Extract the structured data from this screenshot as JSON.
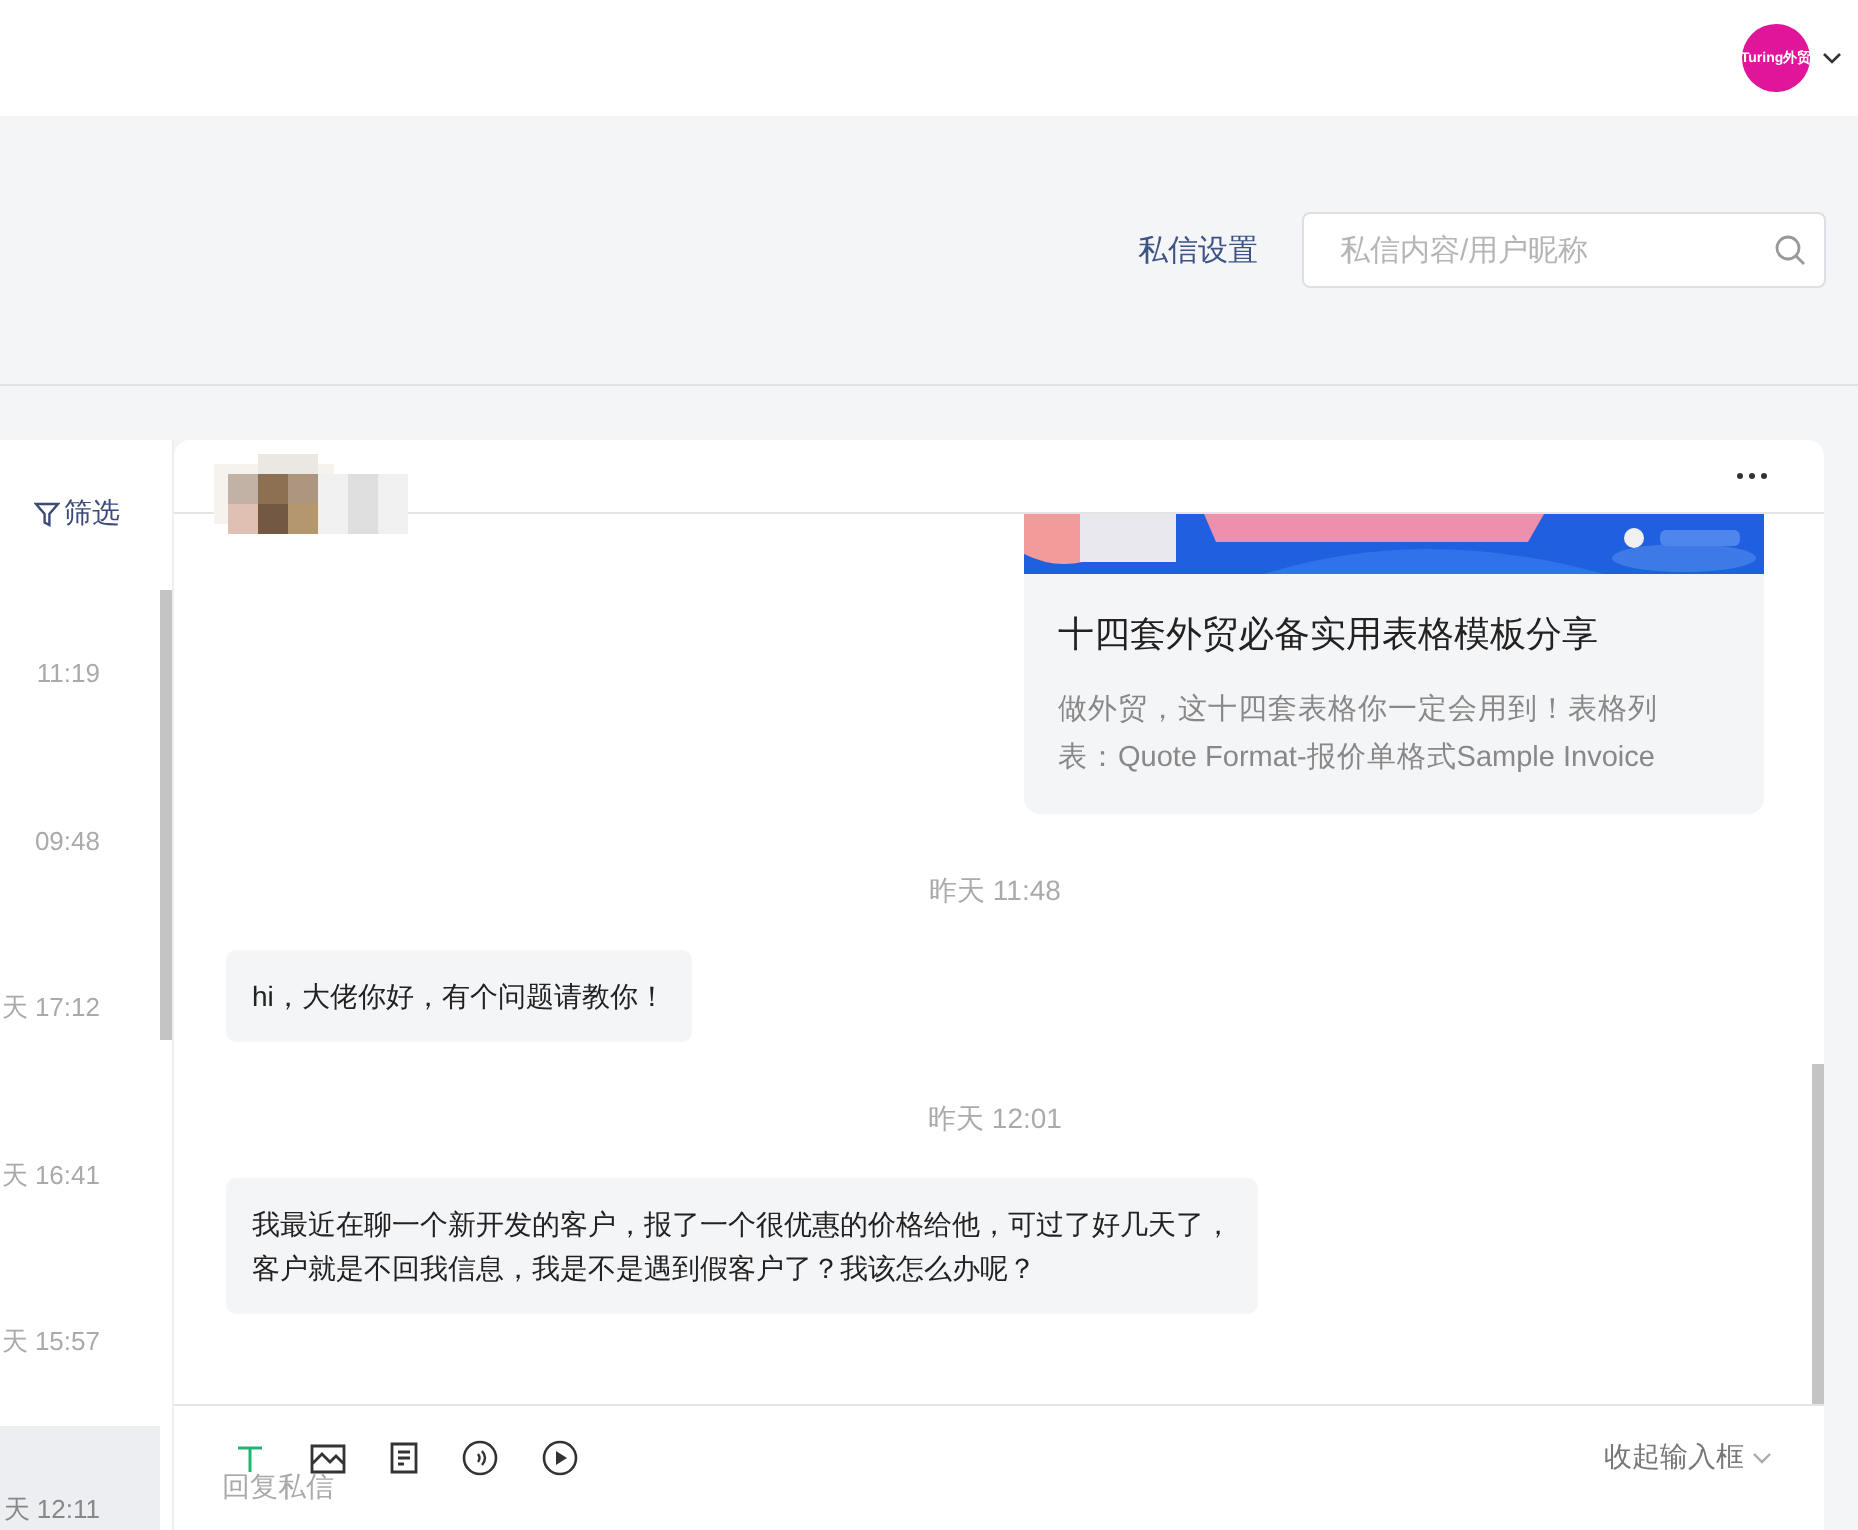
{
  "top_bar": {
    "avatar_text": "Turing外贸"
  },
  "toolbar": {
    "settings_link": "私信设置",
    "search": {
      "placeholder": "私信内容/用户昵称"
    }
  },
  "conversation_list": {
    "filter": "筛选",
    "items": [
      {
        "time": "11:19",
        "selected": false
      },
      {
        "time": "09:48",
        "selected": false
      },
      {
        "time": "天 17:12",
        "selected": false
      },
      {
        "time": "天 16:41",
        "selected": false
      },
      {
        "time": "天 15:57",
        "selected": false
      },
      {
        "time": "天 12:11",
        "selected": true
      }
    ]
  },
  "chat": {
    "messages": [
      {
        "kind": "article",
        "title": "十四套外贸必备实用表格模板分享",
        "summary": "做外贸，这十四套表格你一定会用到！表格列表：Quote Format-报价单格式Sample Invoice"
      },
      {
        "kind": "time",
        "text": "昨天 11:48"
      },
      {
        "kind": "text",
        "text": "hi，大佬你好，有个问题请教你！"
      },
      {
        "kind": "time",
        "text": "昨天 12:01"
      },
      {
        "kind": "text",
        "text": "我最近在聊一个新开发的客户，报了一个很优惠的价格给他，可过了好几天了，客户就是不回我信息，我是不是遇到假客户了？我该怎么办呢？"
      }
    ]
  },
  "composer": {
    "placeholder": "回复私信",
    "collapse": "收起输入框"
  }
}
